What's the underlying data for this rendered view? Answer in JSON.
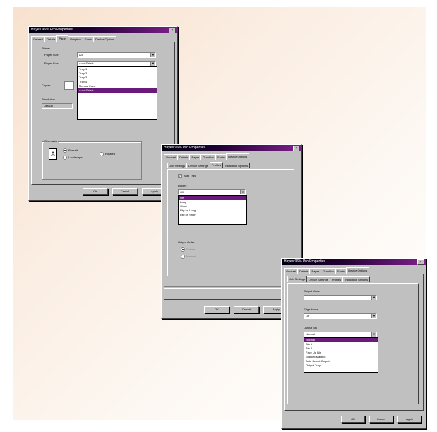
{
  "window1": {
    "title": "Hayes 96% Pro Properties",
    "close": "×",
    "tabs": [
      "General",
      "Details",
      "Paper",
      "Graphics",
      "Fonts",
      "Device Options"
    ],
    "group_label": "Printer",
    "field1_label": "Paper Size",
    "field1_value": "A4",
    "field2_label": "Paper Size",
    "field2_value": "Auto Select",
    "list_items": [
      "Tray 1",
      "Tray 2",
      "Tray 3",
      "Tray 4",
      "Manual Feed",
      "Auto Select"
    ],
    "copies_label": "Copies",
    "res_label": "Resolution",
    "res_value": "Default",
    "orient_label": "Orientation",
    "portrait": "Portrait",
    "landscape": "Landscape",
    "rotated": "Rotated",
    "ok": "OK",
    "cancel": "Cancel",
    "apply": "Apply"
  },
  "window2": {
    "title": "Hayes 96% Pro Properties",
    "close": "×",
    "tabs": [
      "General",
      "Details",
      "Paper",
      "Graphics",
      "Fonts",
      "Device Options"
    ],
    "subtabs": [
      "Job Settings",
      "Device Settings",
      "Profiles",
      "Installable Options"
    ],
    "enable_label": "Auto Tray",
    "section_label": "Duplex",
    "field_value": "Off",
    "list_items": [
      "Off",
      "Long",
      "Short",
      "Flip on Long",
      "Flip on Short"
    ],
    "output_label": "Output Order",
    "output_option": "Collate",
    "output_option2": "Normal",
    "ok": "OK",
    "cancel": "Cancel",
    "apply": "Apply"
  },
  "window3": {
    "title": "Hayes 96% Pro Properties",
    "close": "×",
    "tabs": [
      "General",
      "Details",
      "Paper",
      "Graphics",
      "Fonts",
      "Device Options"
    ],
    "subtabs": [
      "Job Settings",
      "Device Settings",
      "Profiles",
      "Installable Options"
    ],
    "label1": "Output Mode",
    "value1": "",
    "label2": "Edge Mode",
    "value2": "Off",
    "label3": "Output Bin",
    "value3": "Normal",
    "list_items": [
      "Normal",
      "Bin 1",
      "Bin 2",
      "Face Up Bin",
      "Stacker/Mailbox",
      "Auto Select Output",
      "Output Tray"
    ],
    "ok": "OK",
    "cancel": "Cancel",
    "apply": "Apply"
  }
}
